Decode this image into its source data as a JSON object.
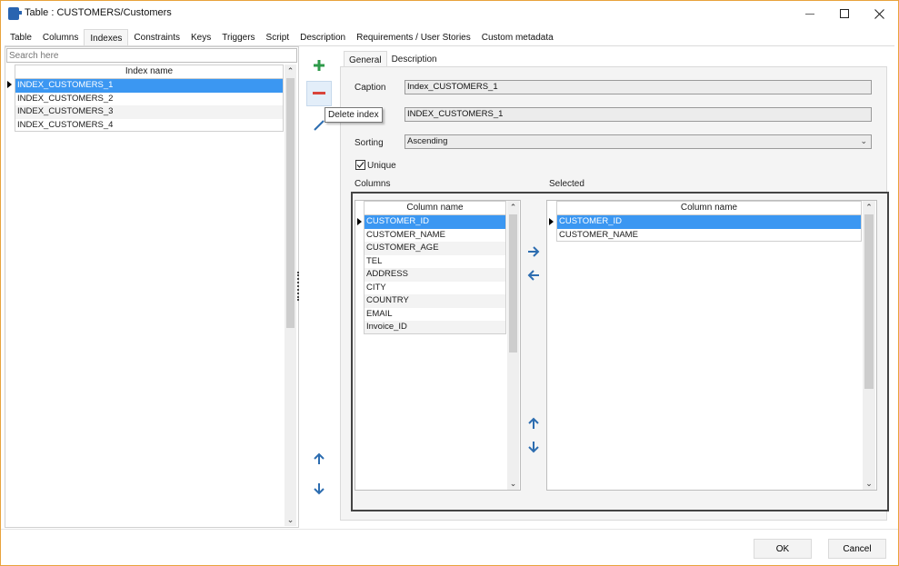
{
  "window": {
    "title": "Table : CUSTOMERS/Customers",
    "controls": {
      "minimize": "minimize",
      "maximize": "maximize",
      "close": "close"
    }
  },
  "main_tabs": [
    {
      "label": "Table",
      "active": false
    },
    {
      "label": "Columns",
      "active": false
    },
    {
      "label": "Indexes",
      "active": true
    },
    {
      "label": "Constraints",
      "active": false
    },
    {
      "label": "Keys",
      "active": false
    },
    {
      "label": "Triggers",
      "active": false
    },
    {
      "label": "Script",
      "active": false
    },
    {
      "label": "Description",
      "active": false
    },
    {
      "label": "Requirements / User Stories",
      "active": false
    },
    {
      "label": "Custom metadata",
      "active": false
    }
  ],
  "index_list": {
    "search_placeholder": "Search here",
    "header": "Index name",
    "rows": [
      "INDEX_CUSTOMERS_1",
      "INDEX_CUSTOMERS_2",
      "INDEX_CUSTOMERS_3",
      "INDEX_CUSTOMERS_4"
    ],
    "selected_index": 0
  },
  "actions": {
    "add": "Add index",
    "delete": "Delete index",
    "edit": "Edit index",
    "move_up": "Move up",
    "move_down": "Move down",
    "tooltip": "Delete index"
  },
  "sub_tabs": [
    {
      "label": "General",
      "active": true
    },
    {
      "label": "Description",
      "active": false
    }
  ],
  "general": {
    "caption_label": "Caption",
    "caption_value": "Index_CUSTOMERS_1",
    "name_value": "INDEX_CUSTOMERS_1",
    "sorting_label": "Sorting",
    "sorting_value": "Ascending",
    "unique_label": "Unique",
    "unique_checked": true,
    "columns_label": "Columns",
    "selected_label": "Selected"
  },
  "available_columns": {
    "header": "Column name",
    "rows": [
      "CUSTOMER_ID",
      "CUSTOMER_NAME",
      "CUSTOMER_AGE",
      "TEL",
      "ADDRESS",
      "CITY",
      "COUNTRY",
      "EMAIL",
      "Invoice_ID"
    ],
    "selected_index": 0
  },
  "selected_columns": {
    "header": "Column name",
    "rows": [
      "CUSTOMER_ID",
      "CUSTOMER_NAME"
    ],
    "selected_index": 0
  },
  "footer": {
    "ok": "OK",
    "cancel": "Cancel"
  },
  "colors": {
    "selection": "#3b97f2",
    "accent_icon": "#2d6db0",
    "add_green": "#2e9a4a",
    "delete_red": "#d9443a",
    "window_border": "#e8a33c"
  }
}
